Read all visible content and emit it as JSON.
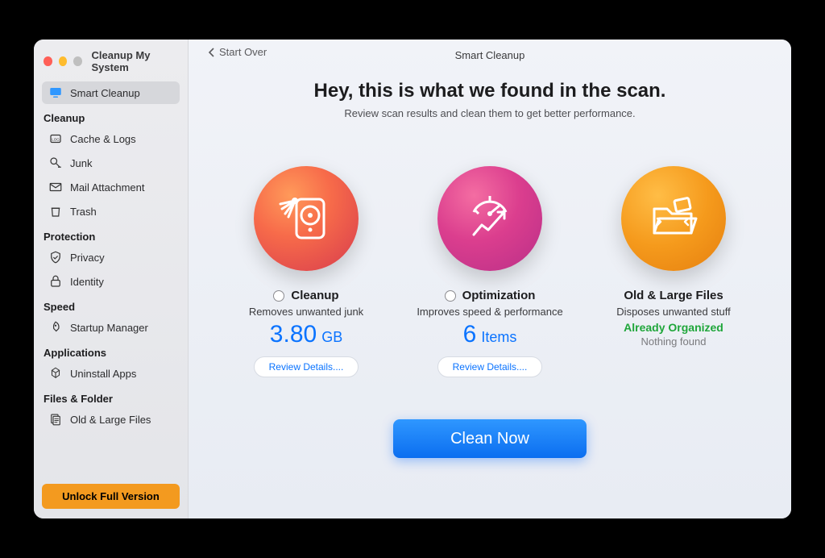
{
  "window": {
    "title": "Cleanup My System"
  },
  "sidebar": {
    "active": {
      "label": "Smart Cleanup"
    },
    "sections": {
      "cleanup": {
        "label": "Cleanup",
        "items": [
          "Cache & Logs",
          "Junk",
          "Mail Attachment",
          "Trash"
        ]
      },
      "protection": {
        "label": "Protection",
        "items": [
          "Privacy",
          "Identity"
        ]
      },
      "speed": {
        "label": "Speed",
        "items": [
          "Startup Manager"
        ]
      },
      "applications": {
        "label": "Applications",
        "items": [
          "Uninstall Apps"
        ]
      },
      "files": {
        "label": "Files & Folder",
        "items": [
          "Old & Large Files"
        ]
      }
    },
    "unlock": "Unlock Full Version"
  },
  "header": {
    "back": "Start Over",
    "title": "Smart Cleanup",
    "headline": "Hey, this is what we found in the scan.",
    "subhead": "Review scan results and clean them to get better performance."
  },
  "cards": {
    "cleanup": {
      "title": "Cleanup",
      "subtitle": "Removes unwanted junk",
      "metric_num": "3.80",
      "metric_unit": "GB",
      "review": "Review Details...."
    },
    "optimization": {
      "title": "Optimization",
      "subtitle": "Improves speed & performance",
      "metric_num": "6",
      "metric_unit": "Items",
      "review": "Review Details...."
    },
    "files": {
      "title": "Old & Large Files",
      "subtitle": "Disposes unwanted stuff",
      "status": "Already Organized",
      "note": "Nothing found"
    }
  },
  "action": {
    "clean": "Clean Now"
  }
}
